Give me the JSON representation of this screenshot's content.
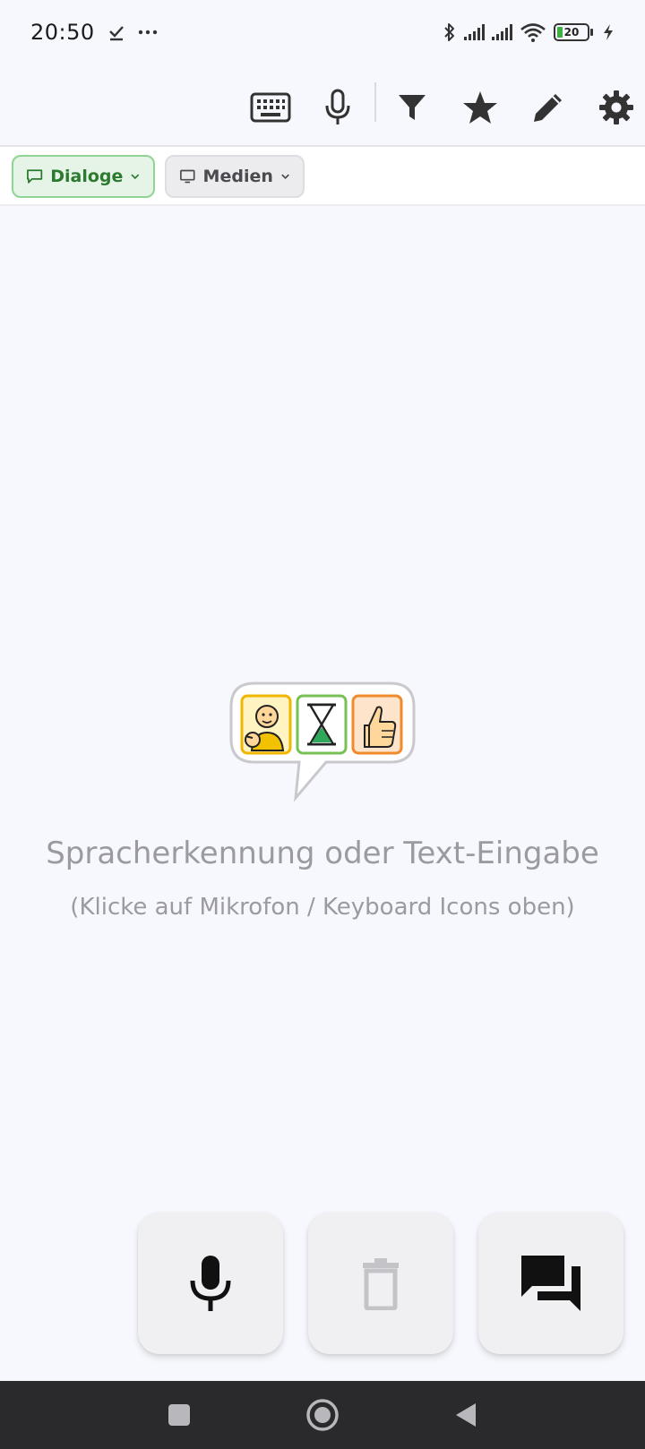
{
  "status_bar": {
    "time": "20:50",
    "left_icons": [
      "check-icon",
      "more-dots-icon"
    ],
    "right_icons": [
      "bluetooth-icon",
      "signal-icon",
      "signal-icon",
      "wifi-icon",
      "battery-icon",
      "charging-icon"
    ],
    "battery_level": "20"
  },
  "toolbar": {
    "icons": [
      "keyboard-icon",
      "microphone-icon",
      "filter-icon",
      "star-icon",
      "edit-pencil-icon",
      "settings-gear-icon"
    ]
  },
  "chips": [
    {
      "label": "Dialoge",
      "icon": "chat-bubble-icon",
      "selected": true
    },
    {
      "label": "Medien",
      "icon": "monitor-icon",
      "selected": false
    }
  ],
  "empty_state": {
    "title": "Spracherkennung oder Text-Eingabe",
    "subtitle": "(Klicke auf Mikrofon / Keyboard Icons oben)"
  },
  "actions": [
    {
      "icon": "microphone-icon",
      "enabled": true
    },
    {
      "icon": "trash-icon",
      "enabled": false
    },
    {
      "icon": "chat-bubbles-icon",
      "enabled": true
    }
  ],
  "nav_bar": {
    "icons": [
      "recents-square-icon",
      "home-circle-icon",
      "back-triangle-icon"
    ]
  },
  "colors": {
    "background": "#f7f8fd",
    "chip_selected_bg": "#e6f4e7",
    "chip_selected_text": "#2b7a2f",
    "nav_bar_bg": "#2a2a2c",
    "icon_dark": "#333333"
  }
}
